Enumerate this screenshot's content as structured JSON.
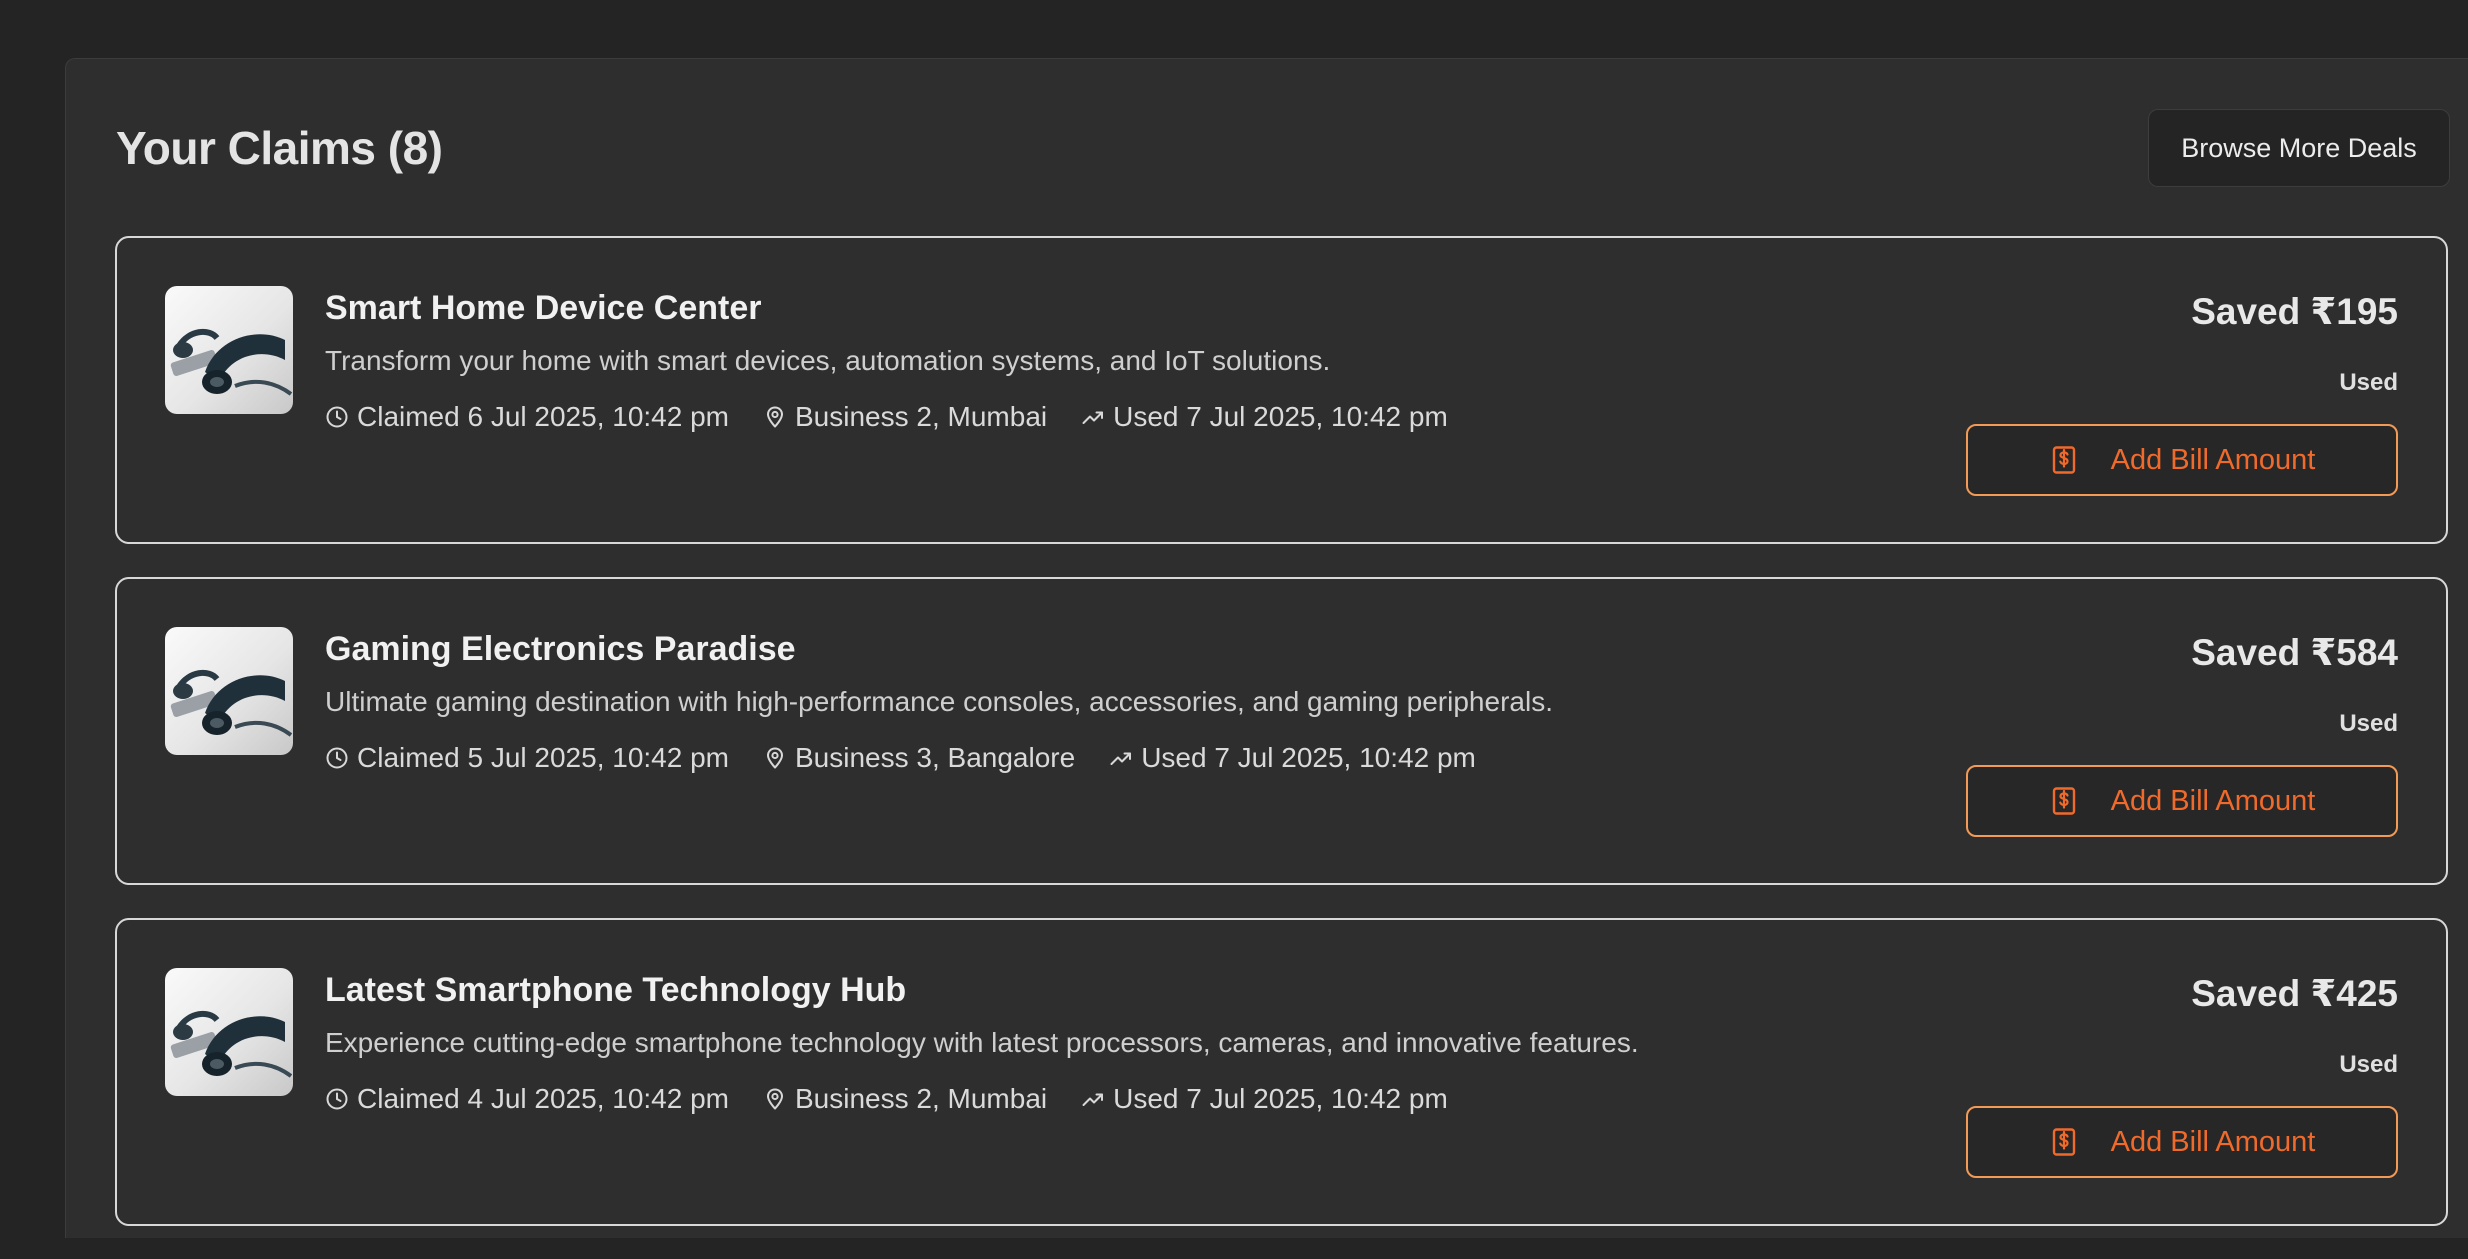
{
  "header": {
    "title": "Your Claims (8)",
    "browse_label": "Browse More Deals"
  },
  "colors": {
    "accent": "#ef6a2b",
    "accent_border": "#f29a56",
    "background": "#242424",
    "panel": "#2e2e2e"
  },
  "claims": [
    {
      "title": "Smart Home Device Center",
      "description": "Transform your home with smart devices, automation systems, and IoT solutions.",
      "claimed": "Claimed 6 Jul 2025, 10:42 pm",
      "location": "Business 2, Mumbai",
      "used": "Used 7 Jul 2025, 10:42 pm",
      "saved": "Saved ₹195",
      "status": "Used",
      "action_label": "Add Bill Amount"
    },
    {
      "title": "Gaming Electronics Paradise",
      "description": "Ultimate gaming destination with high-performance consoles, accessories, and gaming peripherals.",
      "claimed": "Claimed 5 Jul 2025, 10:42 pm",
      "location": "Business 3, Bangalore",
      "used": "Used 7 Jul 2025, 10:42 pm",
      "saved": "Saved ₹584",
      "status": "Used",
      "action_label": "Add Bill Amount"
    },
    {
      "title": "Latest Smartphone Technology Hub",
      "description": "Experience cutting-edge smartphone technology with latest processors, cameras, and innovative features.",
      "claimed": "Claimed 4 Jul 2025, 10:42 pm",
      "location": "Business 2, Mumbai",
      "used": "Used 7 Jul 2025, 10:42 pm",
      "saved": "Saved ₹425",
      "status": "Used",
      "action_label": "Add Bill Amount"
    }
  ]
}
